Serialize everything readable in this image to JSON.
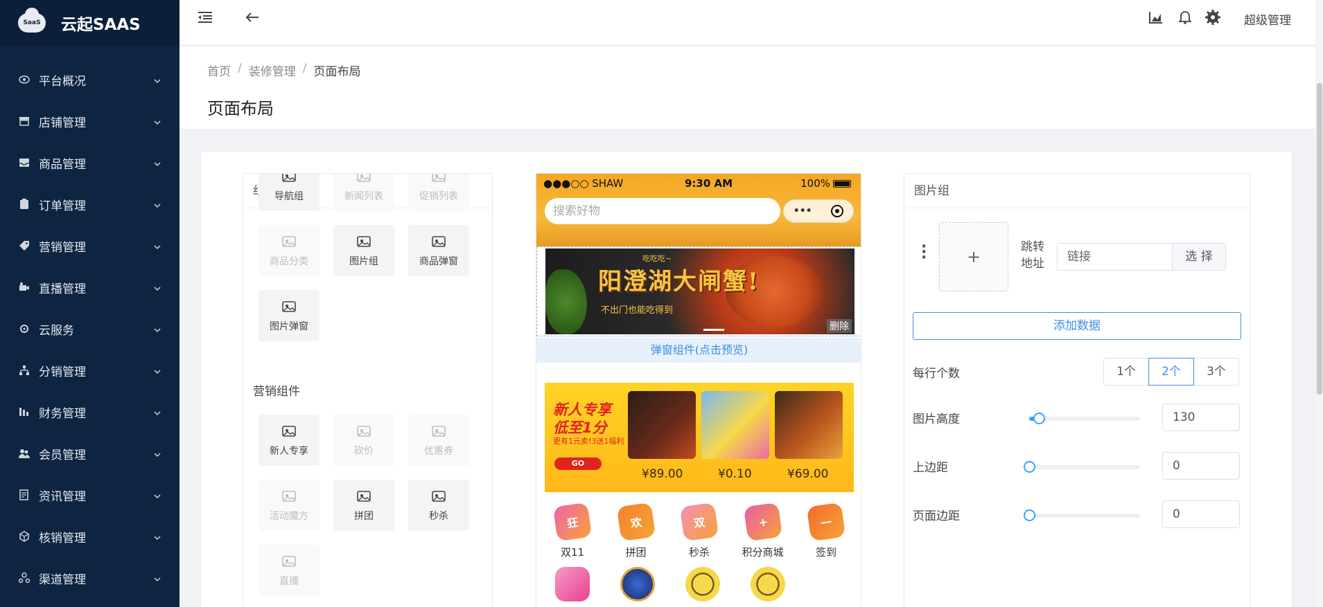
{
  "brand": {
    "logo_text": "SaaS",
    "title": "云起SAAS"
  },
  "sidebar": {
    "items": [
      {
        "label": "平台概况",
        "icon": "eye-icon"
      },
      {
        "label": "店铺管理",
        "icon": "store-icon"
      },
      {
        "label": "商品管理",
        "icon": "inbox-icon"
      },
      {
        "label": "订单管理",
        "icon": "clipboard-icon"
      },
      {
        "label": "营销管理",
        "icon": "tag-icon"
      },
      {
        "label": "直播管理",
        "icon": "camera-icon"
      },
      {
        "label": "云服务",
        "icon": "gear-icon"
      },
      {
        "label": "分销管理",
        "icon": "sitemap-icon"
      },
      {
        "label": "财务管理",
        "icon": "bars-icon"
      },
      {
        "label": "会员管理",
        "icon": "users-icon"
      },
      {
        "label": "资讯管理",
        "icon": "news-icon"
      },
      {
        "label": "核销管理",
        "icon": "cube-icon"
      },
      {
        "label": "渠道管理",
        "icon": "channel-icon"
      }
    ]
  },
  "topbar": {
    "admin_name": "超级管理"
  },
  "breadcrumb": {
    "home": "首页",
    "section": "装修管理",
    "current": "页面布局"
  },
  "page": {
    "title": "页面布局"
  },
  "components_panel": {
    "title": "组件",
    "basic_tiles": [
      {
        "label": "导航组",
        "enabled": true
      },
      {
        "label": "新闻列表",
        "enabled": false
      },
      {
        "label": "促销列表",
        "enabled": false
      },
      {
        "label": "商品分类",
        "enabled": false
      },
      {
        "label": "图片组",
        "enabled": true
      },
      {
        "label": "商品弹窗",
        "enabled": true
      },
      {
        "label": "图片弹窗",
        "enabled": true
      }
    ],
    "marketing_title": "营销组件",
    "marketing_tiles": [
      {
        "label": "新人专享",
        "enabled": true
      },
      {
        "label": "砍价",
        "enabled": false
      },
      {
        "label": "优惠券",
        "enabled": false
      },
      {
        "label": "活动魔方",
        "enabled": false
      },
      {
        "label": "拼团",
        "enabled": true
      },
      {
        "label": "秒杀",
        "enabled": true
      },
      {
        "label": "直播",
        "enabled": false
      }
    ]
  },
  "phone": {
    "carrier": "●●●○○ SHAW",
    "time": "9:30 AM",
    "battery": "100%",
    "search_placeholder": "搜索好物",
    "capsule_dots": "•••",
    "banner": {
      "title": "阳澄湖大闸蟹!",
      "small_text": "吃吃吃~",
      "subtitle": "不出门也能吃得到"
    },
    "delete_label": "删除",
    "popup_link": "弹窗组件(点击预览)",
    "promo": {
      "title_line1": "新人专享",
      "title_line2": "低至1分",
      "note": "更有1元卖!3送1福利",
      "go_label": "GO",
      "prices": [
        "¥89.00",
        "¥0.10",
        "¥69.00"
      ]
    },
    "nav_icons": [
      {
        "glyph": "狂",
        "label": "双11",
        "color": "#f062a8"
      },
      {
        "glyph": "欢",
        "label": "拼团",
        "color": "#f5822a"
      },
      {
        "glyph": "双",
        "label": "秒杀",
        "color": "#f58fb4"
      },
      {
        "glyph": "+",
        "label": "积分商城",
        "color": "#e85ca2"
      },
      {
        "glyph": "一",
        "label": "签到",
        "color": "#f36c2a"
      }
    ]
  },
  "settings": {
    "title": "图片组",
    "upload_plus": "+",
    "jump_label_1": "跳转",
    "jump_label_2": "地址",
    "link_placeholder": "链接",
    "select_label": "选 择",
    "add_button": "添加数据",
    "per_row_label": "每行个数",
    "per_row_options": [
      "1个",
      "2个",
      "3个"
    ],
    "per_row_selected": "2个",
    "image_height_label": "图片高度",
    "image_height_value": "130",
    "top_margin_label": "上边距",
    "top_margin_value": "0",
    "page_margin_label": "页面边距",
    "page_margin_value": "0"
  }
}
